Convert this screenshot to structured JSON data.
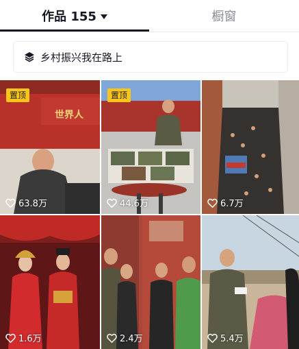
{
  "tabs": {
    "works_label": "作品 155",
    "shop_label": "橱窗"
  },
  "collection": {
    "label": "乡村振兴我在路上"
  },
  "videos": [
    {
      "pinned": true,
      "pin_label": "置顶",
      "likes": "63.8万",
      "banner_text": "世界人"
    },
    {
      "pinned": true,
      "pin_label": "置顶",
      "likes": "44.6万"
    },
    {
      "pinned": false,
      "likes": "6.7万"
    },
    {
      "pinned": false,
      "likes": "1.6万"
    },
    {
      "pinned": false,
      "likes": "2.4万"
    },
    {
      "pinned": false,
      "likes": "5.4万"
    }
  ],
  "colors": {
    "pin_bg": "#f9c51a",
    "active_text": "#161823",
    "inactive_text": "#8a8b91"
  }
}
